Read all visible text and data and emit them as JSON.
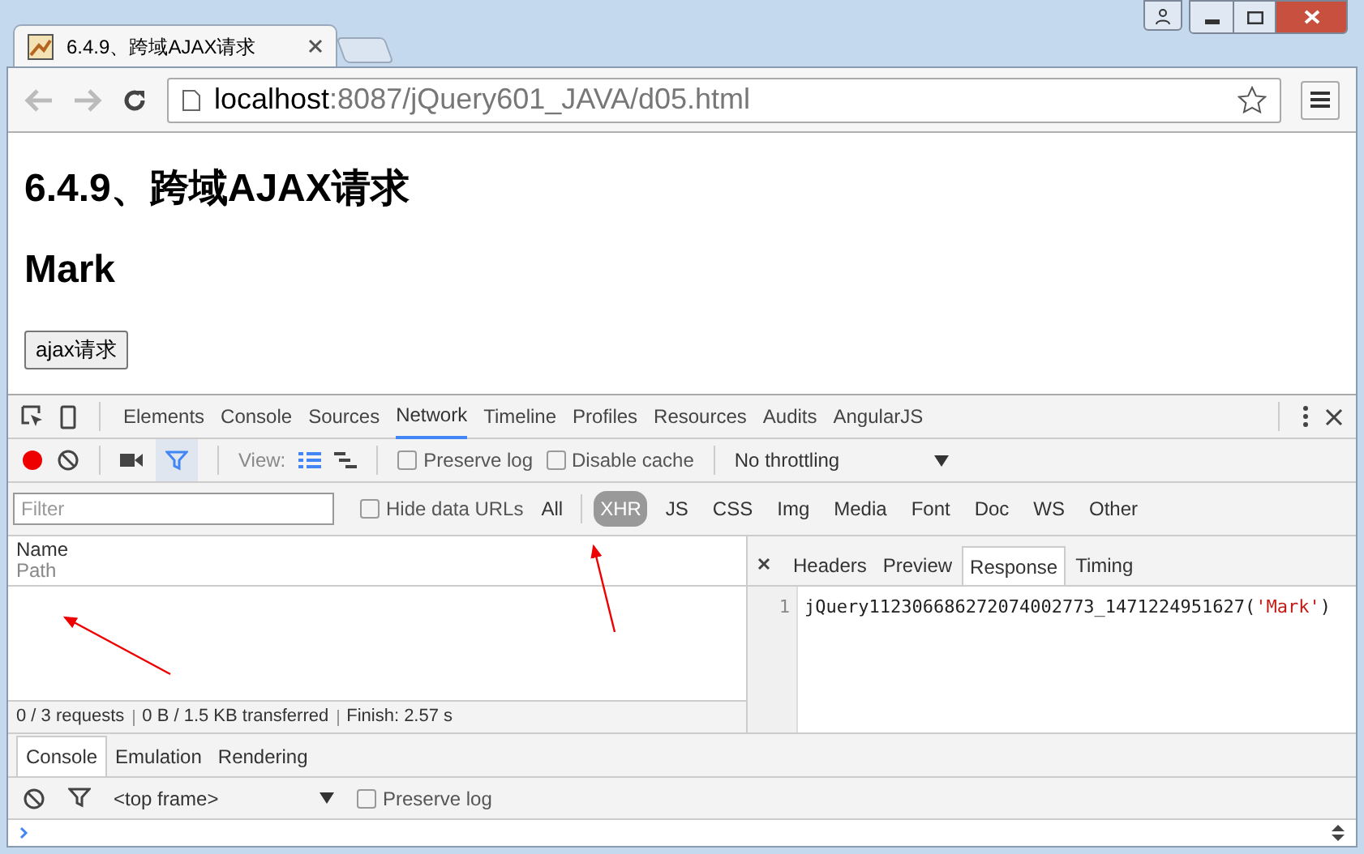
{
  "browser_tab": {
    "title": "6.4.9、跨域AJAX请求"
  },
  "address_bar": {
    "host": "localhost",
    "path": ":8087/jQuery601_JAVA/d05.html"
  },
  "page": {
    "heading": "6.4.9、跨域AJAX请求",
    "subheading": "Mark",
    "button": "ajax请求"
  },
  "devtools": {
    "tabs": [
      {
        "label": "Elements",
        "selected": false
      },
      {
        "label": "Console",
        "selected": false
      },
      {
        "label": "Sources",
        "selected": false
      },
      {
        "label": "Network",
        "selected": true
      },
      {
        "label": "Timeline",
        "selected": false
      },
      {
        "label": "Profiles",
        "selected": false
      },
      {
        "label": "Resources",
        "selected": false
      },
      {
        "label": "Audits",
        "selected": false
      },
      {
        "label": "AngularJS",
        "selected": false
      }
    ],
    "toolbar": {
      "recording": true,
      "filter_active": true,
      "view_label": "View:",
      "preserve_log": {
        "label": "Preserve log",
        "checked": false
      },
      "disable_cache": {
        "label": "Disable cache",
        "checked": false
      },
      "throttling": "No throttling"
    },
    "filter_bar": {
      "placeholder": "Filter",
      "hide_data_urls": {
        "label": "Hide data URLs",
        "checked": false
      },
      "types": [
        {
          "label": "All",
          "selected": false
        },
        {
          "label": "XHR",
          "selected": true
        },
        {
          "label": "JS",
          "selected": false
        },
        {
          "label": "CSS",
          "selected": false
        },
        {
          "label": "Img",
          "selected": false
        },
        {
          "label": "Media",
          "selected": false
        },
        {
          "label": "Font",
          "selected": false
        },
        {
          "label": "Doc",
          "selected": false
        },
        {
          "label": "WS",
          "selected": false
        },
        {
          "label": "Other",
          "selected": false
        }
      ]
    },
    "requests": {
      "column_name": "Name",
      "column_path": "Path",
      "status": [
        "0 / 3 requests",
        "0 B / 1.5 KB transferred",
        "Finish: 2.57 s"
      ]
    },
    "detail": {
      "tabs": [
        {
          "label": "Headers",
          "selected": false
        },
        {
          "label": "Preview",
          "selected": false
        },
        {
          "label": "Response",
          "selected": true
        },
        {
          "label": "Timing",
          "selected": false
        }
      ],
      "lines": [
        {
          "number": "1",
          "parts": [
            {
              "kind": "plain",
              "text": "jQuery112306686272074002773_1471224951627("
            },
            {
              "kind": "string",
              "text": "'Mark'"
            },
            {
              "kind": "plain",
              "text": ")"
            }
          ]
        }
      ]
    },
    "drawer": {
      "tabs": [
        {
          "label": "Console",
          "selected": true
        },
        {
          "label": "Emulation",
          "selected": false
        },
        {
          "label": "Rendering",
          "selected": false
        }
      ],
      "context": "<top frame>",
      "preserve_log": {
        "label": "Preserve log",
        "checked": false
      }
    }
  }
}
